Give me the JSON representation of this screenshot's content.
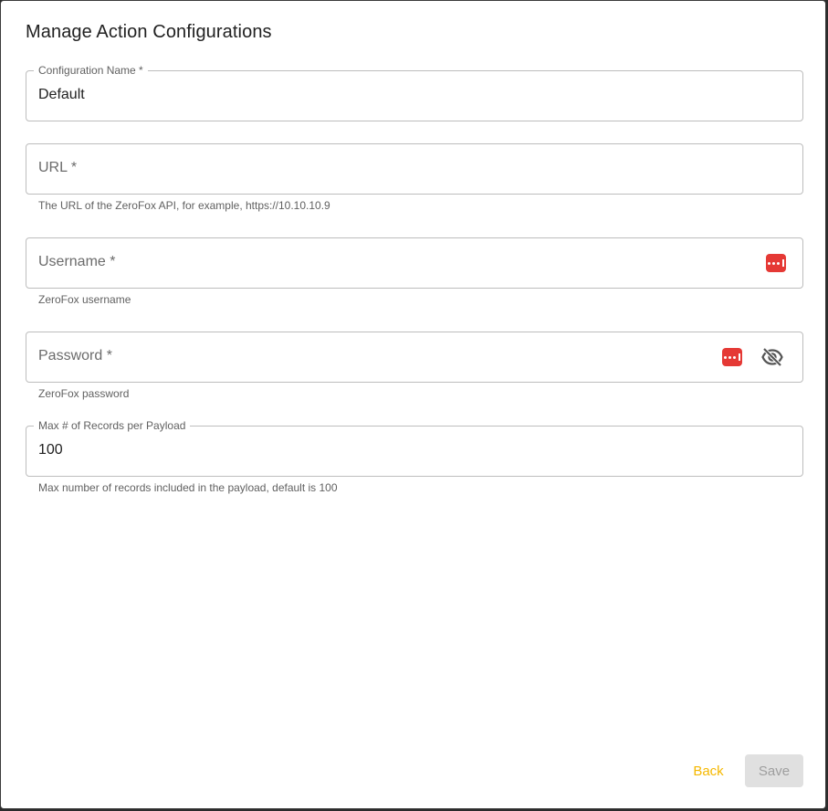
{
  "dialog": {
    "title": "Manage Action Configurations"
  },
  "fields": {
    "config_name": {
      "label": "Configuration Name *",
      "value": "Default"
    },
    "url": {
      "placeholder": "URL *",
      "helper": "The URL of the ZeroFox API, for example, https://10.10.10.9"
    },
    "username": {
      "placeholder": "Username *",
      "helper": "ZeroFox username"
    },
    "password": {
      "placeholder": "Password *",
      "helper": "ZeroFox password"
    },
    "max_records": {
      "label": "Max # of Records per Payload",
      "value": "100",
      "helper": "Max number of records included in the payload, default is 100"
    }
  },
  "actions": {
    "back_label": "Back",
    "save_label": "Save"
  },
  "colors": {
    "accent": "#f5b800",
    "password_manager": "#e53935"
  },
  "icons": {
    "password_manager": "password-manager-icon",
    "visibility_off": "eye-off-icon"
  }
}
